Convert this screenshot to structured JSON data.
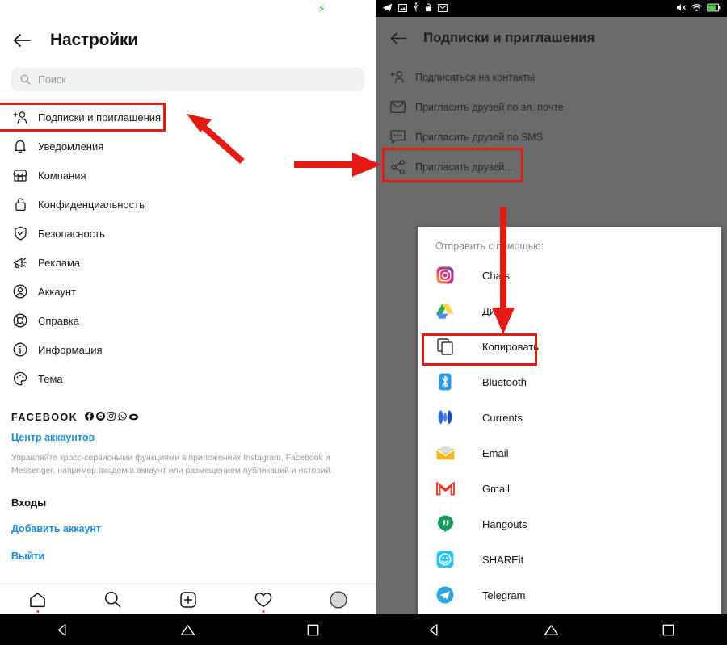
{
  "left_phone": {
    "status_bar": {
      "battery_icon": "battery-charging-icon"
    },
    "header": {
      "back_icon": "back-arrow-icon",
      "title": "Настройки"
    },
    "search": {
      "icon": "search-icon",
      "placeholder": "Поиск",
      "value": ""
    },
    "menu_items": [
      {
        "icon": "person-add-icon",
        "label": "Подписки и приглашения",
        "highlighted": true
      },
      {
        "icon": "bell-icon",
        "label": "Уведомления"
      },
      {
        "icon": "store-icon",
        "label": "Компания"
      },
      {
        "icon": "lock-icon",
        "label": "Конфиденциальность"
      },
      {
        "icon": "shield-check-icon",
        "label": "Безопасность"
      },
      {
        "icon": "megaphone-icon",
        "label": "Реклама"
      },
      {
        "icon": "account-circle-icon",
        "label": "Аккаунт"
      },
      {
        "icon": "lifebuoy-icon",
        "label": "Справка"
      },
      {
        "icon": "info-circle-icon",
        "label": "Информация"
      },
      {
        "icon": "palette-icon",
        "label": "Тема"
      }
    ],
    "facebook_section": {
      "title": "FACEBOOK",
      "brand_icons": [
        "facebook-icon",
        "messenger-icon",
        "instagram-icon",
        "whatsapp-icon",
        "portal-icon"
      ],
      "accounts_center_link": "Центр аккаунтов",
      "description": "Управляйте кросс-сервисными функциями в приложениях Instagram, Facebook и Messenger, например входом в аккаунт или размещением публикаций и историй.",
      "logins_title": "Входы",
      "add_account_link": "Добавить аккаунт",
      "logout_link": "Выйти"
    },
    "tab_bar": [
      {
        "icon": "home-icon",
        "badge": true
      },
      {
        "icon": "search-icon",
        "badge": false
      },
      {
        "icon": "plus-square-icon",
        "badge": false
      },
      {
        "icon": "heart-icon",
        "badge": true
      },
      {
        "icon": "profile-avatar-icon",
        "badge": false
      }
    ],
    "nav_bar": [
      {
        "icon": "android-back-icon"
      },
      {
        "icon": "android-home-icon"
      },
      {
        "icon": "android-recents-icon"
      }
    ]
  },
  "right_phone": {
    "status_bar": {
      "left_icons": [
        "telegram-icon",
        "screenshot-icon",
        "usb-icon",
        "lock-icon",
        "mail-icon"
      ],
      "right_icons": [
        "mute-icon",
        "wifi-icon",
        "battery-icon"
      ]
    },
    "header": {
      "back_icon": "back-arrow-icon",
      "title": "Подписки и приглашения"
    },
    "menu_items": [
      {
        "icon": "person-add-icon",
        "label": "Подписаться на контакты"
      },
      {
        "icon": "envelope-icon",
        "label": "Пригласить друзей по эл. почте"
      },
      {
        "icon": "chat-bubble-icon",
        "label": "Пригласить друзей по SMS"
      },
      {
        "icon": "share-icon",
        "label": "Пригласить друзей...",
        "highlighted": true
      }
    ],
    "share_sheet": {
      "title": "Отправить с помощью:",
      "items": [
        {
          "icon": "instagram-icon",
          "label": "Chats",
          "highlighted": false
        },
        {
          "icon": "google-drive-icon",
          "label": "Диск",
          "highlighted": false
        },
        {
          "icon": "copy-icon",
          "label": "Копировать",
          "highlighted": true
        },
        {
          "icon": "bluetooth-icon",
          "label": "Bluetooth",
          "highlighted": false
        },
        {
          "icon": "currents-icon",
          "label": "Currents",
          "highlighted": false
        },
        {
          "icon": "email-icon",
          "label": "Email",
          "highlighted": false
        },
        {
          "icon": "gmail-icon",
          "label": "Gmail",
          "highlighted": false
        },
        {
          "icon": "hangouts-icon",
          "label": "Hangouts",
          "highlighted": false
        },
        {
          "icon": "shareit-icon",
          "label": "SHAREit",
          "highlighted": false
        },
        {
          "icon": "telegram-icon",
          "label": "Telegram",
          "highlighted": false
        }
      ]
    },
    "nav_bar": [
      {
        "icon": "android-back-icon"
      },
      {
        "icon": "android-home-icon"
      },
      {
        "icon": "android-recents-icon"
      }
    ]
  },
  "annotations": {
    "highlight_color": "#e41b13",
    "boxes": [
      {
        "name": "highlight-subscriptions-invites"
      },
      {
        "name": "highlight-invite-friends"
      },
      {
        "name": "highlight-copy"
      }
    ],
    "arrows": [
      {
        "name": "arrow-to-subscriptions",
        "direction": "up-left"
      },
      {
        "name": "arrow-to-invite-friends",
        "direction": "right"
      },
      {
        "name": "arrow-to-copy",
        "direction": "down"
      }
    ]
  }
}
